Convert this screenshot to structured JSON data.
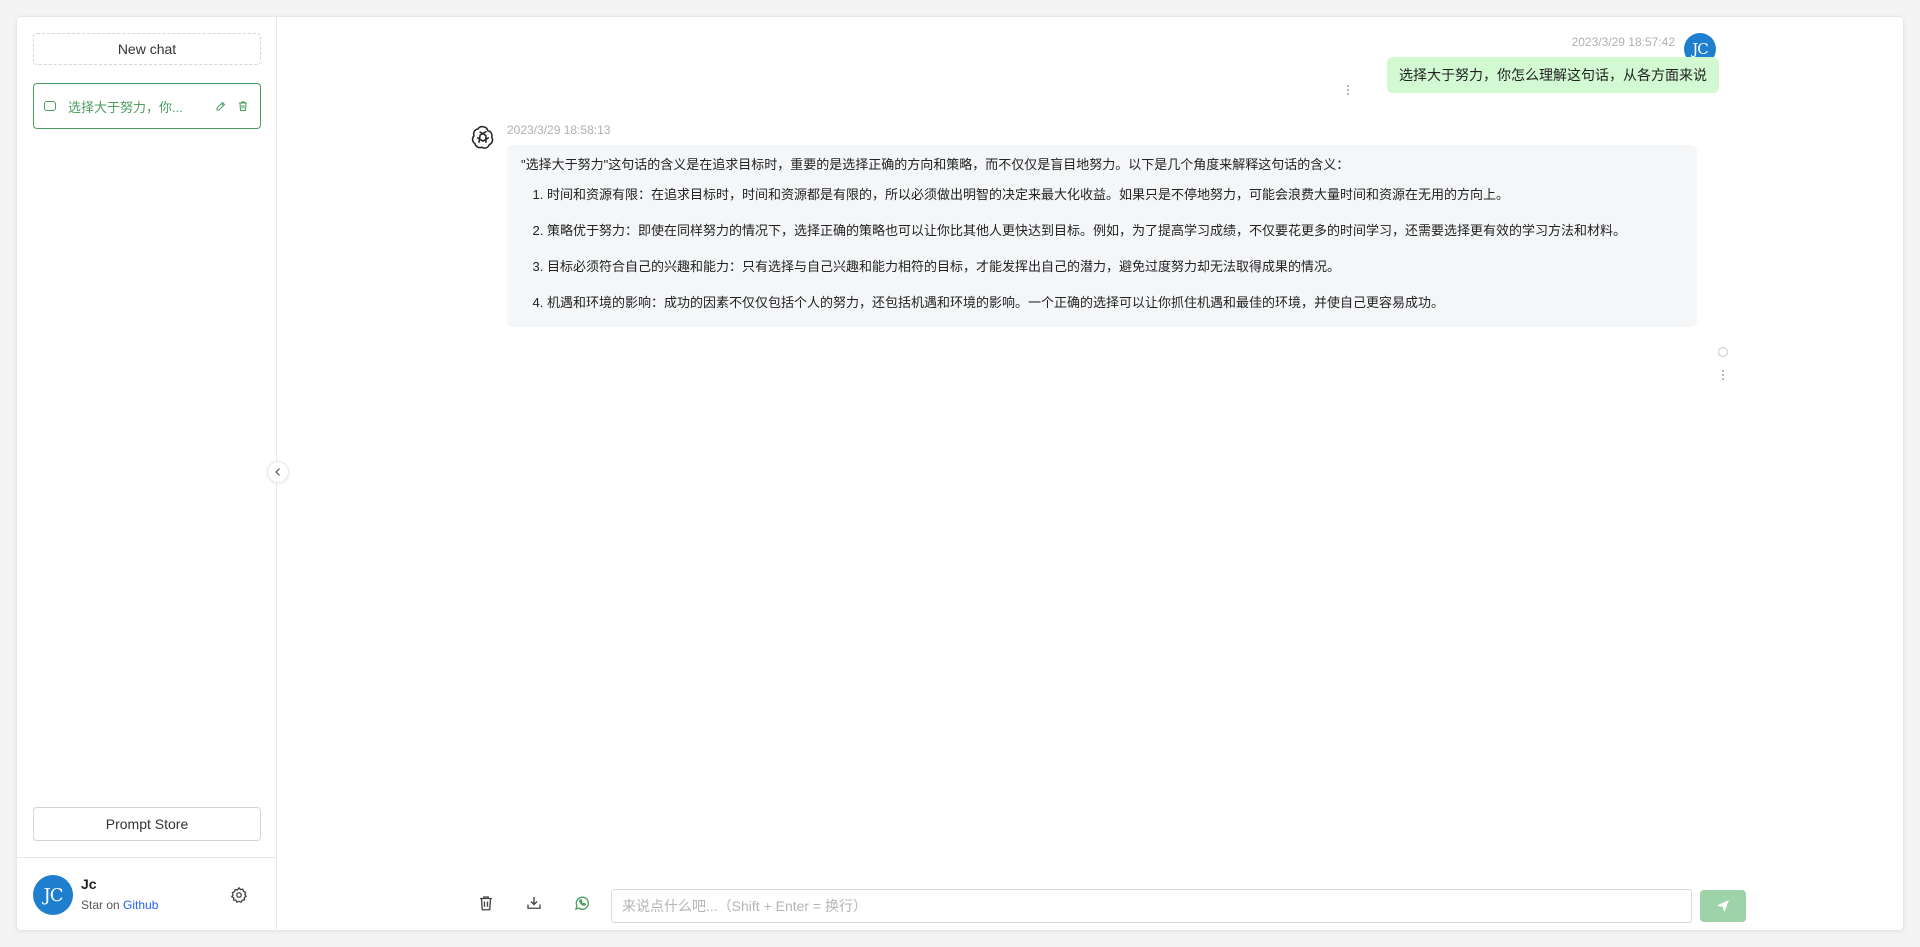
{
  "sidebar": {
    "new_chat_label": "New chat",
    "history": [
      {
        "title": "选择大于努力，你...",
        "icon": "chat-bubble-icon",
        "edit_icon": "edit-icon",
        "delete_icon": "trash-icon"
      }
    ],
    "prompt_store_label": "Prompt Store",
    "user": {
      "avatar_text": "JC",
      "name": "Jc",
      "desc_prefix": "Star on ",
      "desc_link": "Github"
    },
    "settings_icon": "gear-icon",
    "collapse_icon": "chevron-left-icon"
  },
  "messages": [
    {
      "role": "user",
      "time": "2023/3/29 18:57:42",
      "avatar_text": "JC",
      "text": "选择大于努力，你怎么理解这句话，从各方面来说"
    },
    {
      "role": "assistant",
      "time": "2023/3/29 18:58:13",
      "avatar_icon": "openai-logo-icon",
      "intro": "\"选择大于努力\"这句话的含义是在追求目标时，重要的是选择正确的方向和策略，而不仅仅是盲目地努力。以下是几个角度来解释这句话的含义：",
      "points": [
        "时间和资源有限：在追求目标时，时间和资源都是有限的，所以必须做出明智的决定来最大化收益。如果只是不停地努力，可能会浪费大量时间和资源在无用的方向上。",
        "策略优于努力：即使在同样努力的情况下，选择正确的策略也可以让你比其他人更快达到目标。例如，为了提高学习成绩，不仅要花更多的时间学习，还需要选择更有效的学习方法和材料。",
        "目标必须符合自己的兴趣和能力：只有选择与自己兴趣和能力相符的目标，才能发挥出自己的潜力，避免过度努力却无法取得成果的情况。",
        "机遇和环境的影响：成功的因素不仅仅包括个人的努力，还包括机遇和环境的影响。一个正确的选择可以让你抓住机遇和最佳的环境，并使自己更容易成功。"
      ]
    }
  ],
  "input": {
    "placeholder": "来说点什么吧...（Shift + Enter = 换行）",
    "value": "",
    "tools": [
      "trash-icon",
      "download-icon",
      "whatsapp-icon"
    ],
    "send_icon": "send-icon"
  },
  "colors": {
    "accent": "#4b9e5f",
    "user_bubble": "#d2f9d1",
    "bot_bubble": "#f4f6f8",
    "avatar": "#1f7fcf",
    "send_button": "#9ed2a8"
  }
}
